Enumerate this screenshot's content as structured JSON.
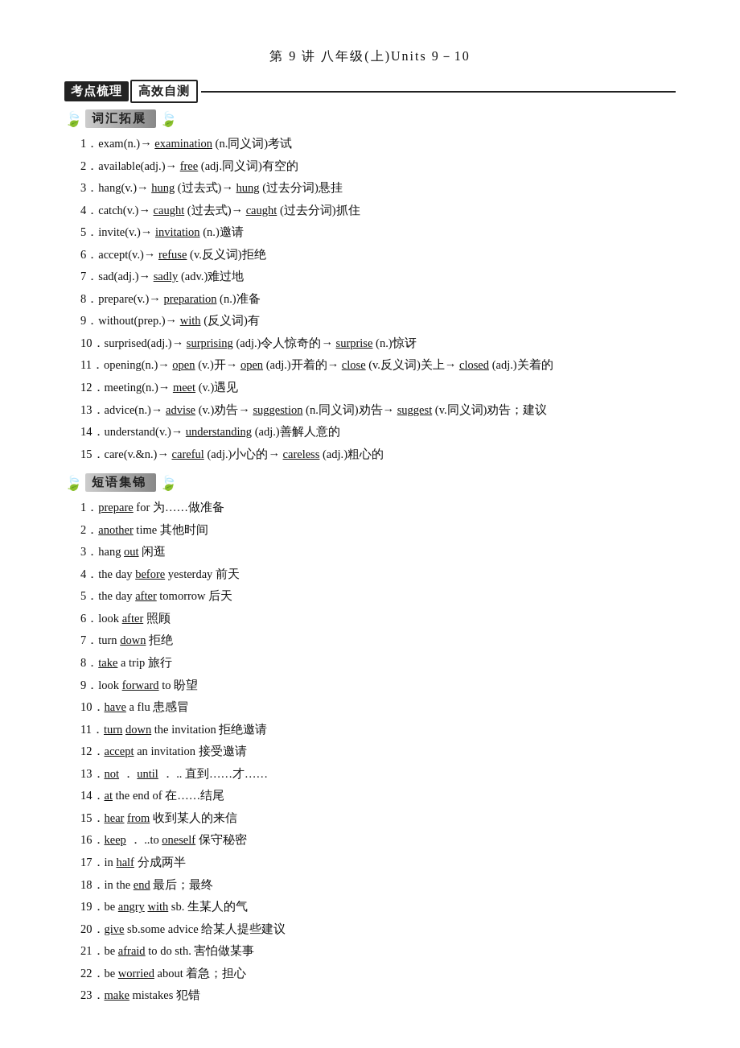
{
  "page": {
    "title": "第 9 讲    八年级(上)Units 9－10",
    "header": {
      "kaodian": "考点梳理",
      "gaoxiao": "高效自测"
    },
    "vocab_section": {
      "title": "词汇拓展",
      "items": [
        "1．exam(n.)→ <u>examination</u>  (n.同义词)考试",
        "2．available(adj.)→ <u>free</u>  (adj.同义词)有空的",
        "3．hang(v.)→ <u>hung</u>  (过去式)→ <u>hung</u>  (过去分词)悬挂",
        "4．catch(v.)→ <u>caught</u>  (过去式)→ <u>caught</u>  (过去分词)抓住",
        "5．invite(v.)→ <u>invitation</u>  (n.)邀请",
        "6．accept(v.)→ <u>refuse</u>  (v.反义词)拒绝",
        "7．sad(adj.)→ <u>sadly</u>  (adv.)难过地",
        "8．prepare(v.)→ <u>preparation</u>  (n.)准备",
        "9．without(prep.)→ <u>with</u>  (反义词)有",
        "10．surprised(adj.)→ <u>surprising</u>  (adj.)令人惊奇的→ <u>surprise</u>  (n.)惊讶",
        "11．opening(n.)→ <u>open</u>  (v.)开→ <u>open</u>  (adj.)开着的→ <u>close</u>  (v.反义词)关上→ <u>closed</u>  (adj.)关着的",
        "12．meeting(n.)→ <u>meet</u>  (v.)遇见",
        "13．advice(n.)→ <u>advise</u>  (v.)劝告→ <u>suggestion</u>  (n.同义词)劝告→ <u>suggest</u>  (v.同义词)劝告；建议",
        "14．understand(v.)→ <u>understanding</u>  (adj.)善解人意的",
        "15．care(v.&n.)→ <u>careful</u>  (adj.)小心的→ <u>careless</u>  (adj.)粗心的"
      ]
    },
    "phrase_section": {
      "title": "短语集锦",
      "items": [
        "1．<u>prepare</u>  for  为……做准备",
        "2．<u>another</u>  time  其他时间",
        "3．hang  <u>out</u>   闲逛",
        "4．the day  <u>before</u>  yesterday  前天",
        "5．the day  <u>after</u>   tomorrow  后天",
        "6．look  <u>after</u>   照顾",
        "7．turn  <u>down</u>   拒绝",
        "8．<u>take</u>  a trip  旅行",
        "9．look  <u>forward</u>      to    盼望",
        "10．<u>have</u>  a flu  患感冒",
        "11．<u>turn</u>    <u>down</u>   the invitation  拒绝邀请",
        "12．<u>accept</u>   an invitation  接受邀请",
        "13．<u>not</u>  ．  <u>until</u>  ．  ..  直到……才……",
        "14．<u>at</u>   the end of  在……结尾",
        "15．<u>hear</u>    <u>from</u>   收到某人的来信",
        "16．<u>keep</u>  ．  ..to  <u>oneself</u>   保守秘密",
        "17．in  <u>half</u>   分成两半",
        "18．in the  <u>end</u>   最后；最终",
        "19．be  <u>angry</u>    <u>with</u>  sb.  生某人的气",
        "20．<u>give</u>   sb.some advice  给某人提些建议",
        "21．be  <u>afraid</u>  to do sth.  害怕做某事",
        "22．be  <u>worried</u>   about  着急；担心",
        "23．<u>make</u>   mistakes  犯错"
      ]
    }
  }
}
